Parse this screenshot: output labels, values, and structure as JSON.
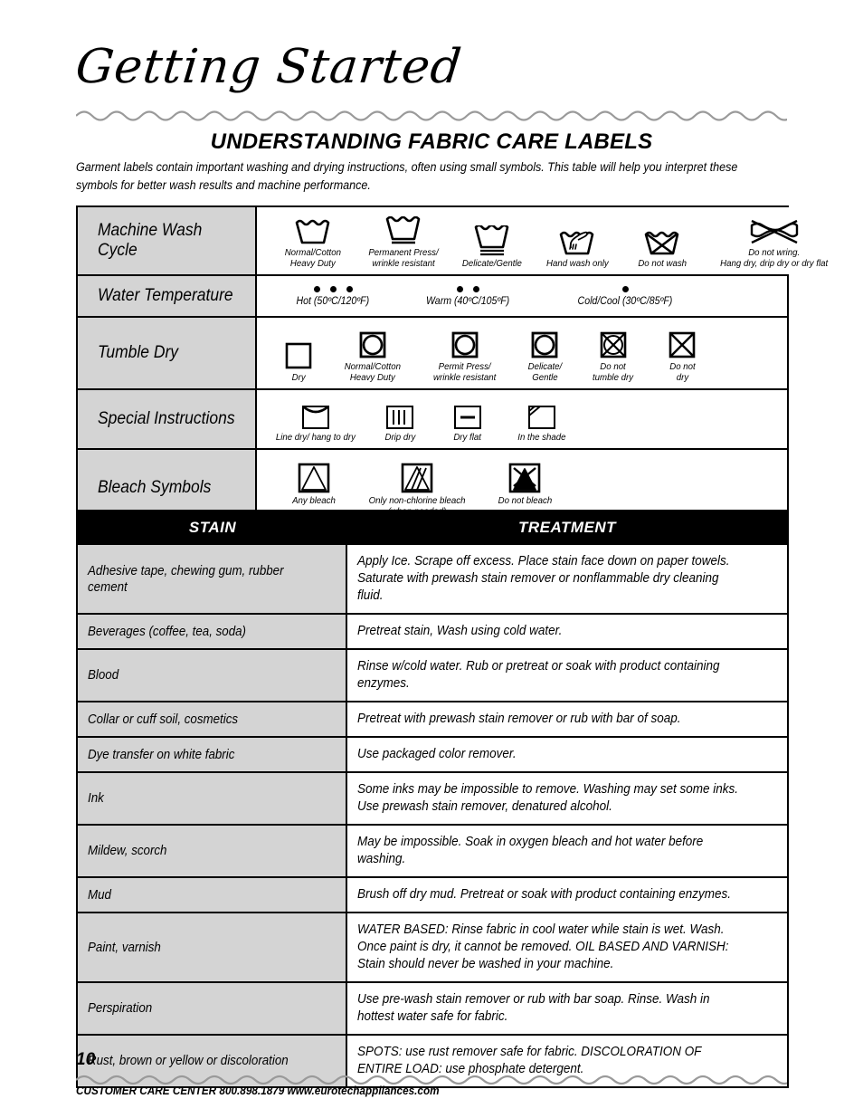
{
  "header": {
    "chapter_title": "Getting Started",
    "section_title": "UNDERSTANDING FABRIC CARE LABELS",
    "intro": "Garment labels contain important washing and drying instructions, often using small symbols. This table will help you interpret these symbols for better wash results and machine performance."
  },
  "symbol_table": {
    "rows": [
      {
        "label": "Machine Wash Cycle",
        "items": [
          {
            "icon": "wash-tub-icon",
            "caption": "Normal/Cotton\nHeavy Duty"
          },
          {
            "icon": "wash-tub-one-bar-icon",
            "caption": "Permanent Press/\nwrinkle resistant"
          },
          {
            "icon": "wash-tub-two-bar-icon",
            "caption": "Delicate/Gentle"
          },
          {
            "icon": "hand-wash-icon",
            "caption": "Hand wash only"
          },
          {
            "icon": "do-not-wash-icon",
            "caption": "Do not wash"
          },
          {
            "icon": "do-not-wring-icon",
            "caption": "Do not wring.\nHang dry, drip dry or dry flat"
          }
        ]
      },
      {
        "label": "Water Temperature",
        "temps": [
          {
            "dots": 3,
            "caption": "Hot (50ºC/120ºF)"
          },
          {
            "dots": 2,
            "caption": "Warm (40ºC/105ºF)"
          },
          {
            "dots": 1,
            "caption": "Cold/Cool (30ºC/85ºF)"
          }
        ]
      },
      {
        "label": "Tumble Dry",
        "items": [
          {
            "icon": "dry-square-icon",
            "caption": "Dry"
          },
          {
            "icon": "tumble-dry-normal-icon",
            "caption": "Normal/Cotton\nHeavy Duty"
          },
          {
            "icon": "tumble-dry-permit-press-icon",
            "caption": "Permit Press/\nwrinkle resistant"
          },
          {
            "icon": "tumble-dry-delicate-icon",
            "caption": "Delicate/\nGentle"
          },
          {
            "icon": "do-not-tumble-dry-icon",
            "caption": "Do not\ntumble dry"
          },
          {
            "icon": "do-not-dry-icon",
            "caption": "Do not\ndry"
          }
        ]
      },
      {
        "label": "Special Instructions",
        "items": [
          {
            "icon": "line-dry-icon",
            "caption": "Line dry/ hang to dry"
          },
          {
            "icon": "drip-dry-icon",
            "caption": "Drip dry"
          },
          {
            "icon": "dry-flat-icon",
            "caption": "Dry flat"
          },
          {
            "icon": "dry-in-shade-icon",
            "caption": "In the shade"
          }
        ]
      },
      {
        "label": "Bleach Symbols",
        "items": [
          {
            "icon": "any-bleach-icon",
            "caption": "Any bleach"
          },
          {
            "icon": "non-chlorine-bleach-icon",
            "caption": "Only non-chlorine bleach\n(when needed)"
          },
          {
            "icon": "do-not-bleach-icon",
            "caption": "Do not bleach"
          }
        ]
      }
    ]
  },
  "stain_table": {
    "headers": {
      "stain": "STAIN",
      "treatment": "TREATMENT"
    },
    "rows": [
      {
        "stain": "Adhesive tape, chewing gum, rubber cement",
        "treatment": "Apply Ice. Scrape off excess. Place stain face down on paper towels. Saturate with prewash stain remover or nonflammable dry cleaning fluid."
      },
      {
        "stain": "Beverages (coffee, tea, soda)",
        "treatment": "Pretreat stain, Wash using cold water."
      },
      {
        "stain": "Blood",
        "treatment": "Rinse w/cold water. Rub or pretreat or soak with product containing enzymes."
      },
      {
        "stain": "Collar or cuff soil, cosmetics",
        "treatment": "Pretreat with prewash stain remover or rub with bar of soap."
      },
      {
        "stain": "Dye transfer on white fabric",
        "treatment": "Use packaged color remover."
      },
      {
        "stain": "Ink",
        "treatment": "Some inks may be impossible to remove. Washing may set some inks. Use prewash stain remover, denatured alcohol."
      },
      {
        "stain": "Mildew, scorch",
        "treatment": "May be impossible. Soak in oxygen bleach and hot water before washing."
      },
      {
        "stain": "Mud",
        "treatment": "Brush off dry mud. Pretreat or soak with product containing enzymes."
      },
      {
        "stain": "Paint, varnish",
        "treatment": "WATER BASED: Rinse fabric in cool water while stain is wet. Wash. Once paint is dry, it cannot be removed. OIL BASED AND VARNISH: Stain should never be washed in your machine."
      },
      {
        "stain": "Perspiration",
        "treatment": "Use pre-wash stain remover or rub with bar soap. Rinse. Wash in hottest water safe for fabric."
      },
      {
        "stain": "Rust, brown or yellow or discoloration",
        "treatment": "SPOTS: use rust remover safe for fabric. DISCOLORATION OF ENTIRE LOAD: use phosphate detergent."
      }
    ]
  },
  "footer": {
    "page_number": "10",
    "contact": "CUSTOMER CARE CENTER 800.898.1879 www.eurotechappliances.com"
  },
  "colors": {
    "label_cell_bg": "#d4d4d4",
    "header_bar_bg": "#000000",
    "wave_rule": "#9a9a9a",
    "text": "#000000"
  }
}
